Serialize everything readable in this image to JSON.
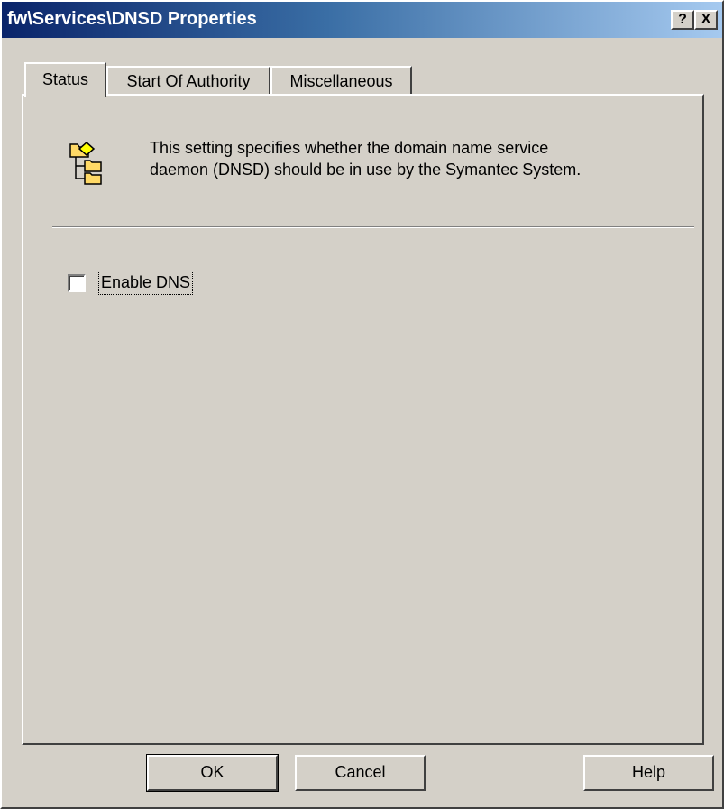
{
  "window": {
    "title": "fw\\Services\\DNSD Properties",
    "help_button": "?",
    "close_button": "X"
  },
  "tabs": [
    {
      "label": "Status",
      "active": true
    },
    {
      "label": "Start Of Authority",
      "active": false
    },
    {
      "label": "Miscellaneous",
      "active": false
    }
  ],
  "status_tab": {
    "icon": "dns-tree-icon",
    "description_line1": "This setting specifies whether the domain name service",
    "description_line2": "daemon (DNSD) should be in use by the Symantec System.",
    "enable_dns_label": "Enable DNS",
    "enable_dns_checked": false
  },
  "buttons": {
    "ok": "OK",
    "cancel": "Cancel",
    "help": "Help"
  },
  "colors": {
    "face": "#d4d0c8",
    "titlebar_start": "#0a246a",
    "titlebar_end": "#a6caf0",
    "icon_yellow": "#ffff00",
    "icon_folder": "#ffd966"
  }
}
